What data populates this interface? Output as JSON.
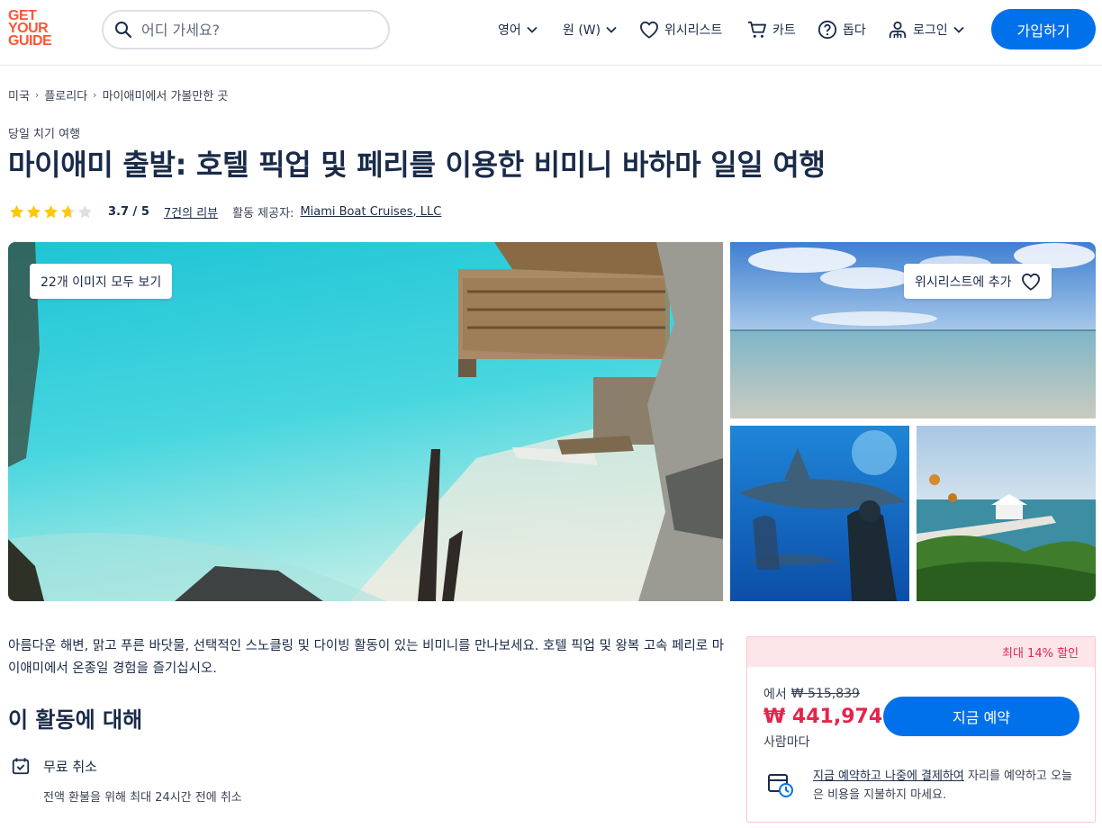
{
  "header": {
    "logo_lines": [
      "GET",
      "YOUR",
      "GUIDE"
    ],
    "search_placeholder": "어디 가세요?",
    "nav": {
      "language": "영어",
      "currency": "원 (W)",
      "wishlist": "위시리스트",
      "cart": "카트",
      "help": "돕다",
      "login": "로그인"
    },
    "signup": "가입하기"
  },
  "breadcrumb": [
    "미국",
    "플로리다",
    "마이애미에서 가볼만한 곳"
  ],
  "category": "당일 치기 여행",
  "title": "마이애미 출발: 호텔 픽업 및 페리를 이용한 비미니 바하마 일일 여행",
  "rating": {
    "stars": 3.7,
    "score": "3.7 / 5",
    "reviews": "7건의 리뷰",
    "provider_label": "활동 제공자:",
    "provider": "Miami Boat Cruises, LLC"
  },
  "gallery": {
    "view_all": "22개 이미지 모두 보기",
    "add_wishlist": "위시리스트에 추가"
  },
  "description": "아름다운 해변, 맑고 푸른 바닷물, 선택적인 스노클링 및 다이빙 활동이 있는 비미니를 만나보세요. 호텔 픽업 및 왕복 고속 페리로 마이애미에서 온종일 경험을 즐기십시오.",
  "about": {
    "title": "이 활동에 대해",
    "feature_title": "무료 취소",
    "feature_sub": "전액 환불을 위해 최대 24시간 전에 취소"
  },
  "booking": {
    "discount": "최대 14% 할인",
    "from": "에서",
    "old_price": "₩ 515,839",
    "price": "₩ 441,974",
    "per": "사람마다",
    "button": "지금 예약",
    "reserve_link": "지금 예약하고 나중에 결제하여",
    "reserve_rest": " 자리를 예약하고 오늘은 비용을 지불하지 마세요."
  },
  "colors": {
    "brand": "#ff5533",
    "primary": "#0071eb",
    "sale": "#e5244a",
    "text": "#1a2b49",
    "star": "#ffc700"
  }
}
